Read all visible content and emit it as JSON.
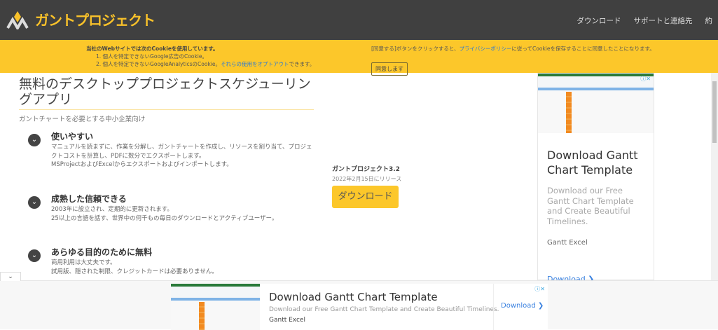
{
  "header": {
    "logo_text": "ガントプロジェクト",
    "nav": [
      "ダウンロード",
      "サポートと連絡先",
      "約"
    ],
    "colors": {
      "bg": "#404040",
      "accent": "#f8c12a"
    }
  },
  "cookie": {
    "heading": "当社のWebサイトでは次のCookieを使用しています。",
    "item1": "1. 個人を特定できないGoogle広告のCookie。",
    "item2_pre": "2. 個人を特定できないGoogleAnalyticsのCookie。",
    "item2_link": "それらの使用をオプトアウト",
    "item2_post": "できます。",
    "right_pre": "[同意する]ボタンをクリックすると、",
    "right_link": "プライバシーポリシー",
    "right_post": "に従ってCookieを保存することに同意したことになります。",
    "agree_label": "同意します"
  },
  "main": {
    "title": "無料のデスクトッププロジェクトスケジューリングアプリ",
    "subtitle": "ガントチャートを必要とする中小企業向け",
    "features": [
      {
        "heading": "使いやすい",
        "lines": [
          "マニュアルを読まずに、作業を分解し、ガントチャートを作成し、リソースを割り当て、プロジェクトコストを計算し、PDFに数分でエクスポートします。",
          "MSProjectおよびExcelからエクスポートおよびインポートします。"
        ]
      },
      {
        "heading": "成熟した信頼できる",
        "lines": [
          "2003年に設立され、定期的に更新されます。",
          "25以上の言語を話す、世界中の何千もの毎日のダウンロードとアクティブユーザー。"
        ]
      },
      {
        "heading": "あらゆる目的のために無料",
        "lines": [
          "商用利用は大丈夫です。",
          "試用版、隠された制限、クレジットカードは必要ありません。"
        ]
      }
    ],
    "release": {
      "version": "ガントプロジェクト3.2",
      "date": "2022年2月15日にリリース",
      "download_label": "ダウンロード"
    }
  },
  "side_ad": {
    "headline": "Download Gantt Chart Template",
    "description": "Download our Free Gantt Chart Template and Create Beautiful Timelines.",
    "brand": "Gantt Excel",
    "link": "Download ❯"
  },
  "bottom_ad": {
    "headline": "Download Gantt Chart Template",
    "description": "Download our Free Gantt Chart Template and Create Beautiful Timelines.",
    "brand": "Gantt Excel",
    "link": "Download ❯"
  }
}
